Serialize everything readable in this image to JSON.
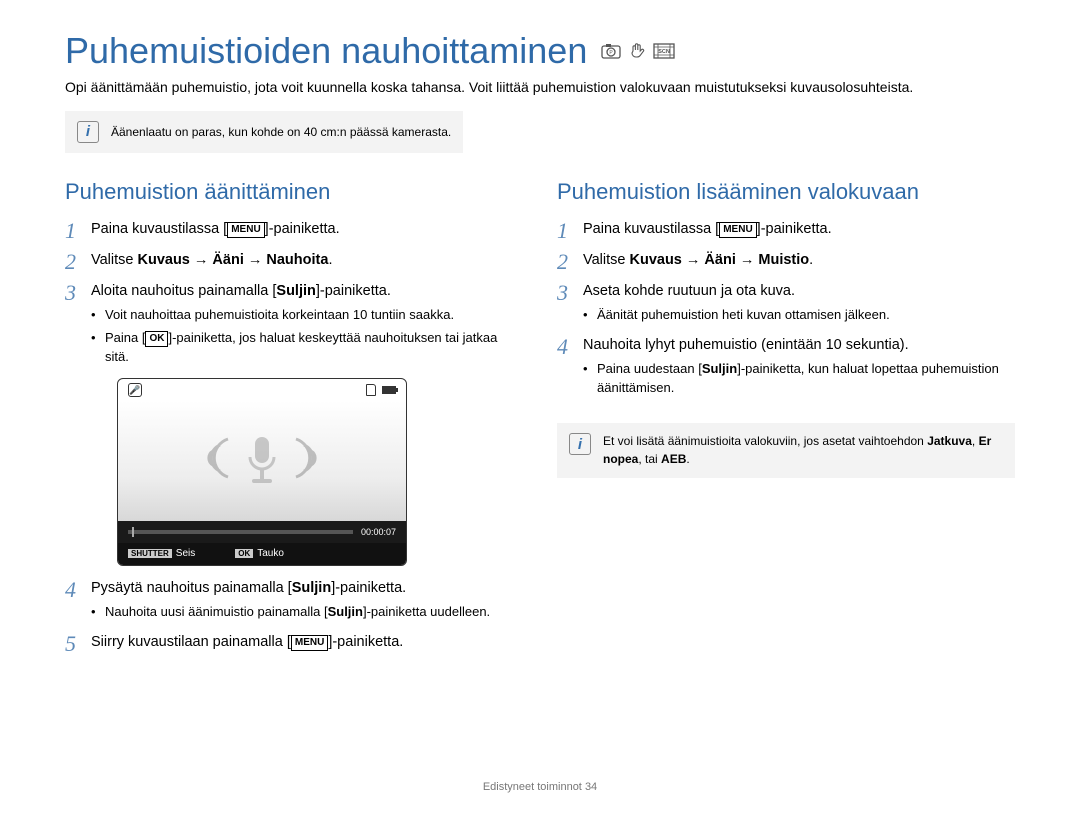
{
  "title": "Puhemuistioiden nauhoittaminen",
  "title_icon_names": [
    "camera-mode-icon",
    "hand-icon",
    "scene-mode-icon"
  ],
  "intro": "Opi äänittämään puhemuistio, jota voit kuunnella koska tahansa. Voit liittää puhemuistion valokuvaan muistutukseksi kuvausolosuhteista.",
  "top_note": "Äänenlaatu on paras, kun kohde on 40 cm:n päässä kamerasta.",
  "left": {
    "heading": "Puhemuistion äänittäminen",
    "step1_pre": "Paina kuvaustilassa [",
    "step1_btn": "MENU",
    "step1_post": "]-painiketta.",
    "step2_pre": "Valitse ",
    "step2_bold": "Kuvaus → Ääni → Nauhoita",
    "step2_post": ".",
    "step3_pre": "Aloita nauhoitus painamalla [",
    "step3_bold": "Suljin",
    "step3_post": "]-painiketta.",
    "step3_sub1": "Voit nauhoittaa puhemuistioita korkeintaan 10 tuntiin saakka.",
    "step3_sub2_pre": "Paina [",
    "step3_sub2_btn": "OK",
    "step3_sub2_post": "]-painiketta, jos haluat keskeyttää nauhoituksen tai jatkaa sitä.",
    "preview": {
      "time": "00:00:07",
      "btn_stop_label": "SHUTTER",
      "btn_stop_text": "Seis",
      "btn_pause_label": "OK",
      "btn_pause_text": "Tauko"
    },
    "step4_pre": "Pysäytä nauhoitus painamalla [",
    "step4_bold": "Suljin",
    "step4_post": "]-painiketta.",
    "step4_sub1_pre": "Nauhoita uusi äänimuistio painamalla [",
    "step4_sub1_bold": "Suljin",
    "step4_sub1_post": "]-painiketta uudelleen.",
    "step5_pre": "Siirry kuvaustilaan painamalla [",
    "step5_btn": "MENU",
    "step5_post": "]-painiketta."
  },
  "right": {
    "heading": "Puhemuistion lisääminen valokuvaan",
    "step1_pre": "Paina kuvaustilassa [",
    "step1_btn": "MENU",
    "step1_post": "]-painiketta.",
    "step2_pre": "Valitse ",
    "step2_bold": "Kuvaus → Ääni → Muistio",
    "step2_post": ".",
    "step3": "Aseta kohde ruutuun ja ota kuva.",
    "step3_sub1": "Äänität puhemuistion heti kuvan ottamisen jälkeen.",
    "step4": "Nauhoita lyhyt puhemuistio (enintään 10 sekuntia).",
    "step4_sub1_pre": "Paina uudestaan [",
    "step4_sub1_bold": "Suljin",
    "step4_sub1_post": "]-painiketta, kun haluat lopettaa puhemuistion äänittämisen.",
    "note_pre": "Et voi lisätä äänimuistioita valokuviin, jos asetat vaihtoehdon ",
    "note_bold1": "Jatkuva",
    "note_mid": ", ",
    "note_bold2": "Er nopea",
    "note_mid2": ", tai ",
    "note_bold3": "AEB",
    "note_post": "."
  },
  "footer_pre": "Edistyneet toiminnot  ",
  "footer_page": "34"
}
